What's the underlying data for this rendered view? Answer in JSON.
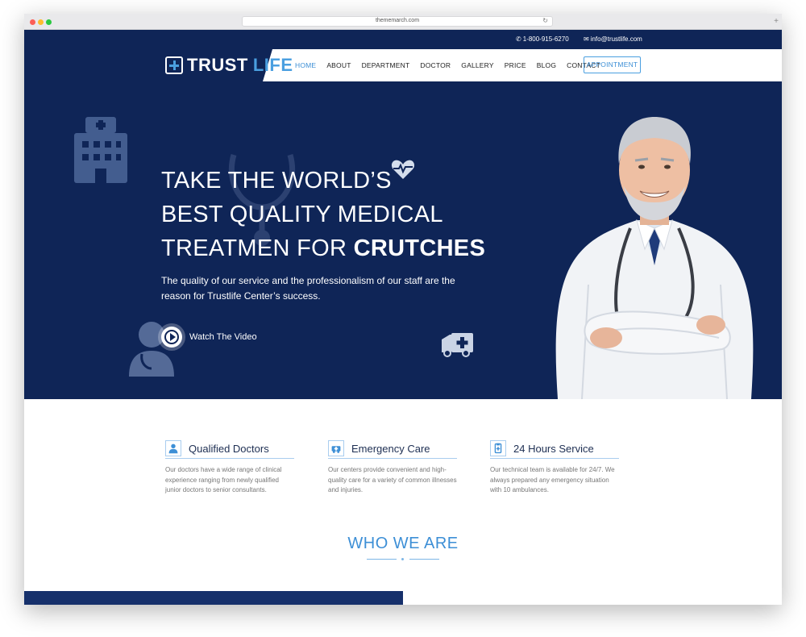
{
  "browser": {
    "url": "thememarch.com"
  },
  "topbar": {
    "phone": "1-800-915-6270",
    "email": "info@trustlife.com"
  },
  "logo": {
    "trust": "TRUST",
    "life": "LIFE"
  },
  "nav": {
    "items": [
      {
        "label": "HOME"
      },
      {
        "label": "ABOUT"
      },
      {
        "label": "DEPARTMENT"
      },
      {
        "label": "DOCTOR"
      },
      {
        "label": "GALLERY"
      },
      {
        "label": "PRICE"
      },
      {
        "label": "BLOG"
      },
      {
        "label": "CONTACT"
      }
    ],
    "active": "HOME",
    "appointment": "APPOINTMENT"
  },
  "hero": {
    "line1": "TAKE THE WORLD’S",
    "line2": "BEST QUALITY MEDICAL",
    "line3_regular": "TREATMEN FOR ",
    "line3_bold": "CRUTCHES",
    "subtext": "The quality of our service and the professionalism of our staff are the reason for Trustlife Center’s success.",
    "watch": "Watch The Video"
  },
  "features": [
    {
      "title": "Qualified Doctors",
      "icon": "doctor-icon",
      "description": "Our doctors have a wide range of clinical experience ranging from newly qualified junior doctors to senior consultants."
    },
    {
      "title": "Emergency Care",
      "icon": "ambulance-icon",
      "description": "Our centers provide convenient and high-quality care for a variety of common illnesses and injuries."
    },
    {
      "title": "24 Hours Service",
      "icon": "clipboard-icon",
      "description": "Our technical team is available for 24/7. We always prepared any emergency situation with 10 ambulances."
    }
  ],
  "section": {
    "who_we_are": "WHO WE ARE"
  },
  "colors": {
    "navy": "#0f2557",
    "accent": "#3d8fd6"
  }
}
